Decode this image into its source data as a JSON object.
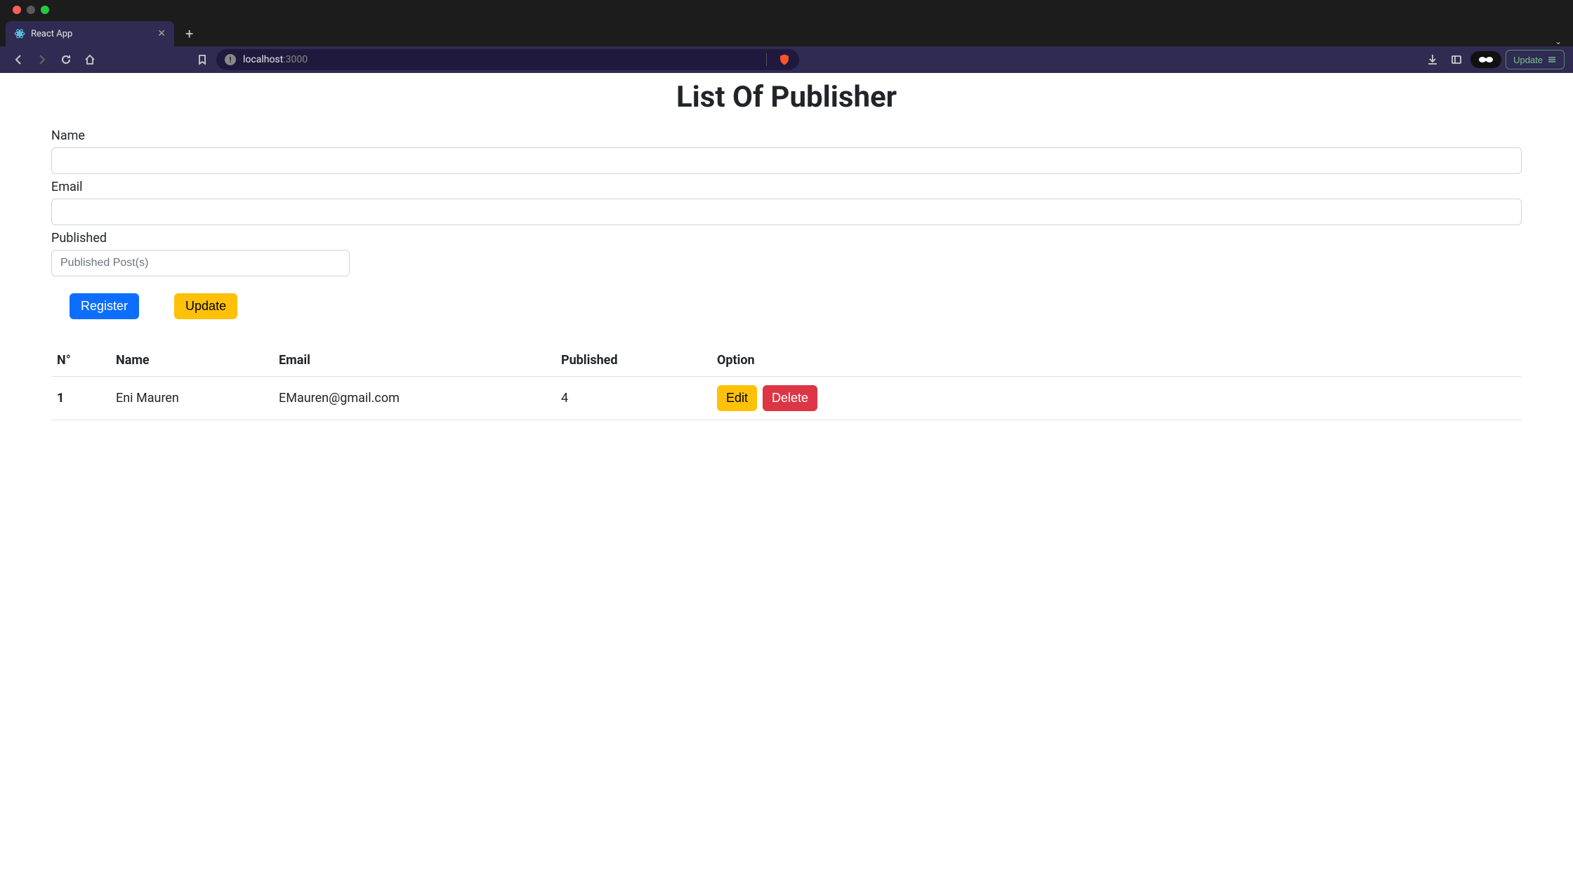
{
  "browser": {
    "tab_title": "React App",
    "url_host": "localhost",
    "url_port": ":3000",
    "update_label": "Update"
  },
  "page": {
    "title": "List Of Publisher"
  },
  "form": {
    "name_label": "Name",
    "name_value": "",
    "email_label": "Email",
    "email_value": "",
    "published_label": "Published",
    "published_value": "",
    "published_placeholder": "Published Post(s)",
    "register_label": "Register",
    "update_label": "Update"
  },
  "table": {
    "headers": {
      "no": "N°",
      "name": "Name",
      "email": "Email",
      "published": "Published",
      "option": "Option"
    },
    "rows": [
      {
        "no": "1",
        "name": "Eni Mauren",
        "email": "EMauren@gmail.com",
        "published": "4",
        "edit_label": "Edit",
        "delete_label": "Delete"
      }
    ]
  }
}
